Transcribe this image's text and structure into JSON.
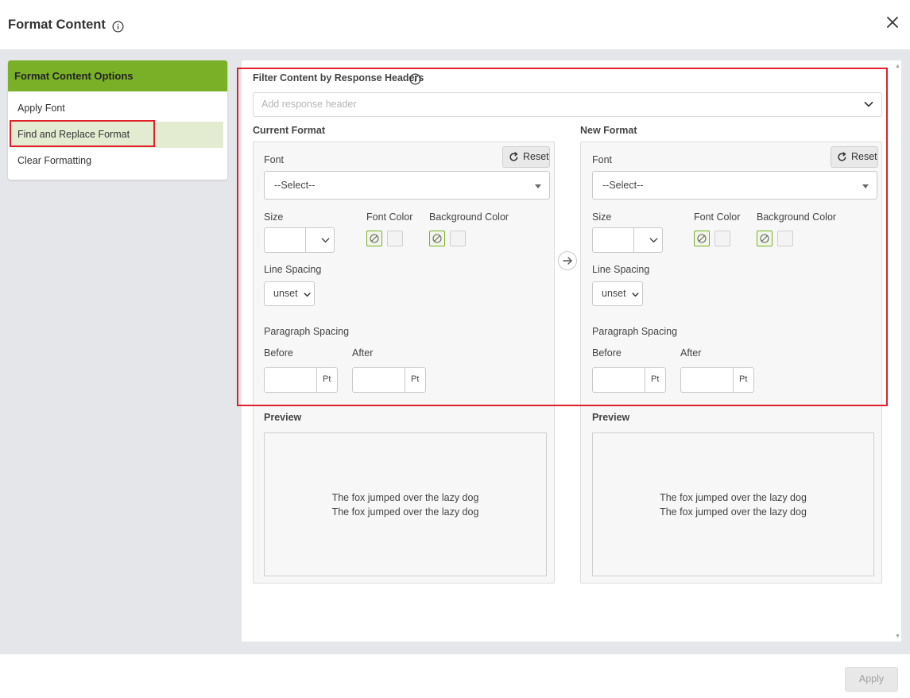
{
  "header": {
    "title": "Format Content",
    "info_icon": "info-icon",
    "close_icon": "close-icon"
  },
  "sidebar": {
    "heading": "Format Content Options",
    "items": [
      {
        "label": "Apply Font",
        "active": false
      },
      {
        "label": "Find and Replace Format",
        "active": true
      },
      {
        "label": "Clear Formatting",
        "active": false
      }
    ]
  },
  "filter": {
    "label": "Filter Content by Response Headers",
    "placeholder": "Add response header"
  },
  "current_format": {
    "heading": "Current Format",
    "reset_label": "Reset",
    "font_label": "Font",
    "font_value": "--Select--",
    "size_label": "Size",
    "font_color_label": "Font Color",
    "background_color_label": "Background Color",
    "line_spacing_label": "Line Spacing",
    "line_spacing_value": "unset",
    "paragraph_spacing_label": "Paragraph Spacing",
    "before_label": "Before",
    "after_label": "After",
    "unit": "Pt",
    "preview_label": "Preview",
    "preview_lines": [
      "The fox jumped over the lazy dog",
      "The fox jumped over the lazy dog"
    ]
  },
  "new_format": {
    "heading": "New Format",
    "reset_label": "Reset",
    "font_label": "Font",
    "font_value": "--Select--",
    "size_label": "Size",
    "font_color_label": "Font Color",
    "background_color_label": "Background Color",
    "line_spacing_label": "Line Spacing",
    "line_spacing_value": "unset",
    "paragraph_spacing_label": "Paragraph Spacing",
    "before_label": "Before",
    "after_label": "After",
    "unit": "Pt",
    "preview_label": "Preview",
    "preview_lines": [
      "The fox jumped over the lazy dog",
      "The fox jumped over the lazy dog"
    ]
  },
  "footer": {
    "apply_label": "Apply"
  },
  "colors": {
    "accent_green": "#7aaf28",
    "active_item_bg": "#e3ecd1",
    "highlight_red": "#e0202a"
  }
}
